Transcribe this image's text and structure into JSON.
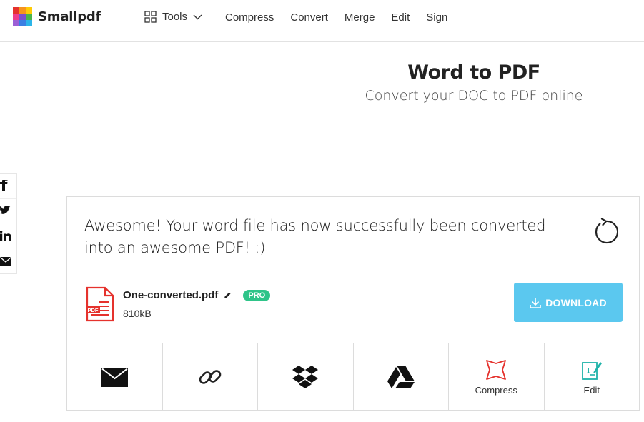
{
  "header": {
    "brand": "Smallpdf",
    "tools_label": "Tools",
    "nav": [
      "Compress",
      "Convert",
      "Merge",
      "Edit",
      "Sign"
    ]
  },
  "hero": {
    "title": "Word to PDF",
    "subtitle": "Convert your DOC to PDF online"
  },
  "social": [
    "facebook-icon",
    "twitter-icon",
    "linkedin-icon",
    "mail-icon"
  ],
  "result": {
    "message": "Awesome! Your word file has now successfully been converted into an awesome PDF! :)",
    "file_name": "One-converted.pdf",
    "file_badge": "PDF",
    "pro_label": "PRO",
    "file_size": "810kB",
    "download_label": "DOWNLOAD"
  },
  "actions": [
    {
      "icon": "email-icon",
      "label": ""
    },
    {
      "icon": "link-icon",
      "label": ""
    },
    {
      "icon": "dropbox-icon",
      "label": ""
    },
    {
      "icon": "google-drive-icon",
      "label": ""
    },
    {
      "icon": "compress-icon",
      "label": "Compress"
    },
    {
      "icon": "edit-icon",
      "label": "Edit"
    }
  ],
  "colors": {
    "download_button": "#5bc8ef",
    "pro_badge": "#2fc489",
    "pdf_red": "#e5322d",
    "edit_teal": "#1fb3a9"
  }
}
